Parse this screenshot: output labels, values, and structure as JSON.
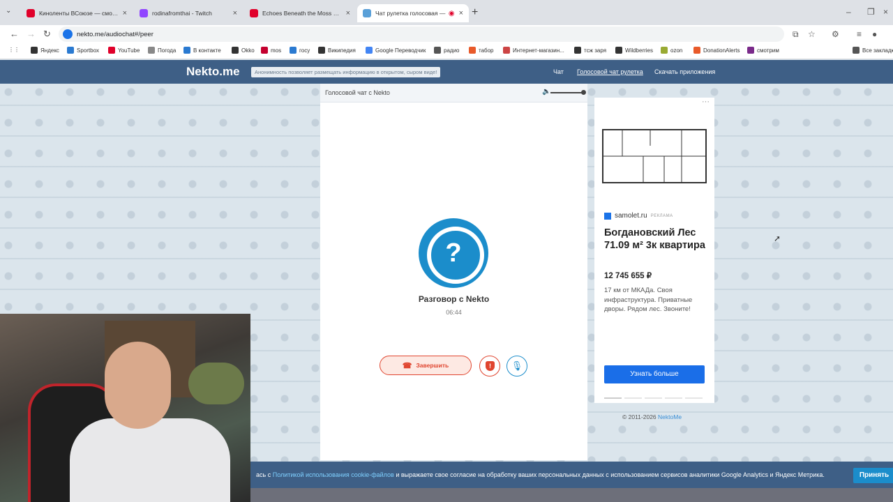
{
  "browser": {
    "tabs": [
      {
        "title": "Киноленты ВСоюзе — смотре",
        "color": "#e0002a",
        "active": false
      },
      {
        "title": "rodinafromthai - Twitch",
        "color": "#9146ff",
        "active": false
      },
      {
        "title": "Echoes Beneath the Moss Orga",
        "color": "#e0002a",
        "active": false
      },
      {
        "title": "Чат рулетка голосовая —",
        "color": "#5aa0d8",
        "active": true
      }
    ],
    "url": "nekto.me/audiochat#/peer",
    "bookmarks": [
      {
        "label": "Яндекс",
        "color": "#333"
      },
      {
        "label": "Sportbox",
        "color": "#2a7ad1"
      },
      {
        "label": "YouTube",
        "color": "#e0002a"
      },
      {
        "label": "Погода",
        "color": "#888"
      },
      {
        "label": "В контакте",
        "color": "#2a7ad1"
      },
      {
        "label": "Okko",
        "color": "#333"
      },
      {
        "label": "mos",
        "color": "#c4002f"
      },
      {
        "label": "госу",
        "color": "#2a7ad1"
      },
      {
        "label": "Википедия",
        "color": "#333"
      },
      {
        "label": "Google Переводчик",
        "color": "#4285f4"
      },
      {
        "label": "радио",
        "color": "#555"
      },
      {
        "label": "табор",
        "color": "#e85a2a"
      },
      {
        "label": "Интернет-магазин...",
        "color": "#c44"
      },
      {
        "label": "тсж заря",
        "color": "#333"
      },
      {
        "label": "Wildberries",
        "color": "#333"
      },
      {
        "label": "ozon",
        "color": "#9a3"
      },
      {
        "label": "DonationAlerts",
        "color": "#e85a2a"
      },
      {
        "label": "смотрим",
        "color": "#7a2a8a"
      },
      {
        "label": "Все закладки",
        "color": "#555"
      }
    ]
  },
  "site": {
    "logo": "Nekto.me",
    "tagline": "Анонимность позволяет размещать информацию в открытом, сыром виде!",
    "nav": [
      {
        "label": "Чат",
        "active": false
      },
      {
        "label": "Голосовой чат рулетка",
        "active": true
      },
      {
        "label": "Скачать приложения",
        "active": false
      }
    ]
  },
  "chat": {
    "header_title": "Голосовой чат с Nekto",
    "volume_percent": 100,
    "avatar_glyph": "?",
    "talk_title": "Разговор с Nekto",
    "timer": "06:44",
    "end_label": "Завершить",
    "report_glyph": "!"
  },
  "ad": {
    "domain": "samolet.ru",
    "tag": "РЕКЛАМА",
    "title": "Богдановский Лес 71.09 м² 3к квартира",
    "price": "12 745 655 ₽",
    "description": "17 км от МКАДа. Своя инфраструктура. Приватные дворы. Рядом лес. Звоните!",
    "cta": "Узнать больше",
    "menu": "···",
    "accent": "#1a6ee8"
  },
  "footer": {
    "copyright": "© 2011-2026",
    "link": "NektoMe"
  },
  "cookie": {
    "prefix": "ась с",
    "link": "Политикой использования cookie-файлов",
    "suffix": "и выражаете свое согласие на обработку ваших персональных данных с использованием сервисов аналитики Google Analytics и Яндекс Метрика.",
    "accept": "Принять"
  },
  "colors": {
    "header_bg": "#3e5f86",
    "brand_blue": "#1b8dcb",
    "end_red": "#e0452f"
  }
}
